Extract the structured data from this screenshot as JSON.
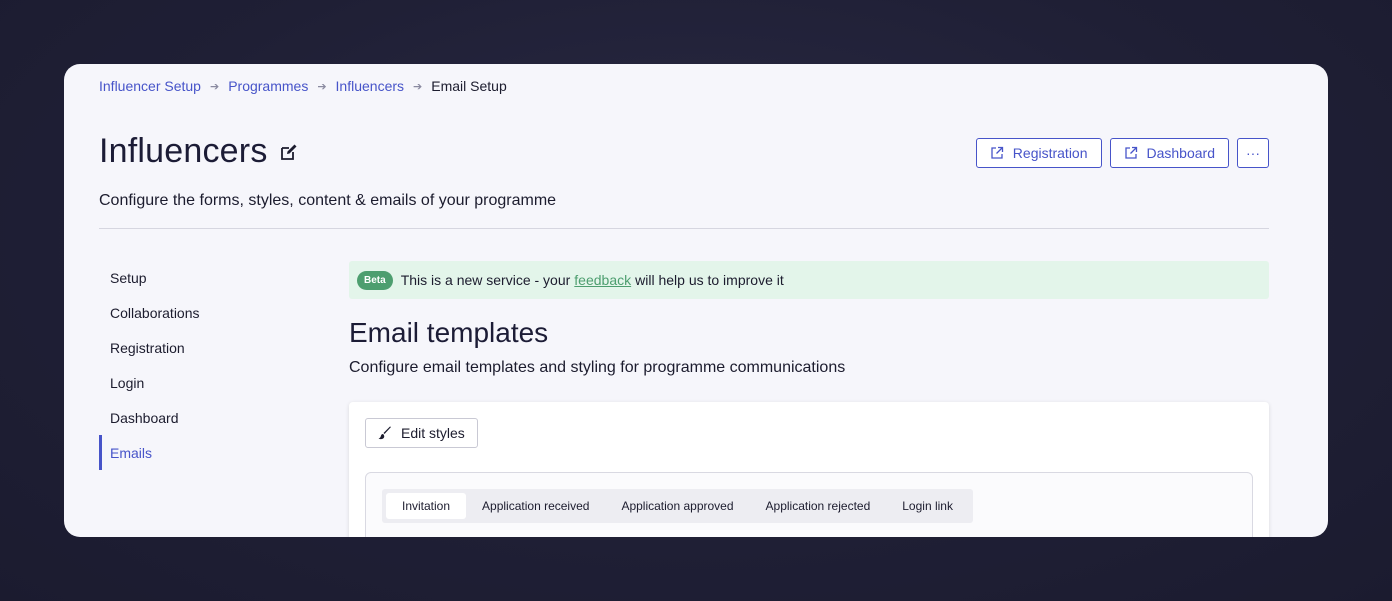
{
  "breadcrumb": {
    "items": [
      "Influencer Setup",
      "Programmes",
      "Influencers"
    ],
    "current": "Email Setup"
  },
  "header": {
    "title": "Influencers",
    "subtitle": "Configure the forms, styles, content & emails of your programme",
    "actions": {
      "registration": "Registration",
      "dashboard": "Dashboard",
      "more": "···"
    }
  },
  "sidebar": {
    "items": [
      {
        "label": "Setup"
      },
      {
        "label": "Collaborations"
      },
      {
        "label": "Registration"
      },
      {
        "label": "Login"
      },
      {
        "label": "Dashboard"
      },
      {
        "label": "Emails",
        "active": true
      }
    ]
  },
  "banner": {
    "badge": "Beta",
    "text_before": "This is a new service - your",
    "link": "feedback",
    "text_after": "will help us to improve it"
  },
  "main": {
    "title": "Email templates",
    "description": "Configure email templates and styling for programme communications",
    "edit_styles": "Edit styles",
    "tabs": [
      {
        "label": "Invitation",
        "active": true
      },
      {
        "label": "Application received"
      },
      {
        "label": "Application approved"
      },
      {
        "label": "Application rejected"
      },
      {
        "label": "Login link"
      }
    ]
  },
  "colors": {
    "accent": "#4754c9",
    "beta_green": "#4d9e6f",
    "banner_bg": "#e3f5ea"
  }
}
